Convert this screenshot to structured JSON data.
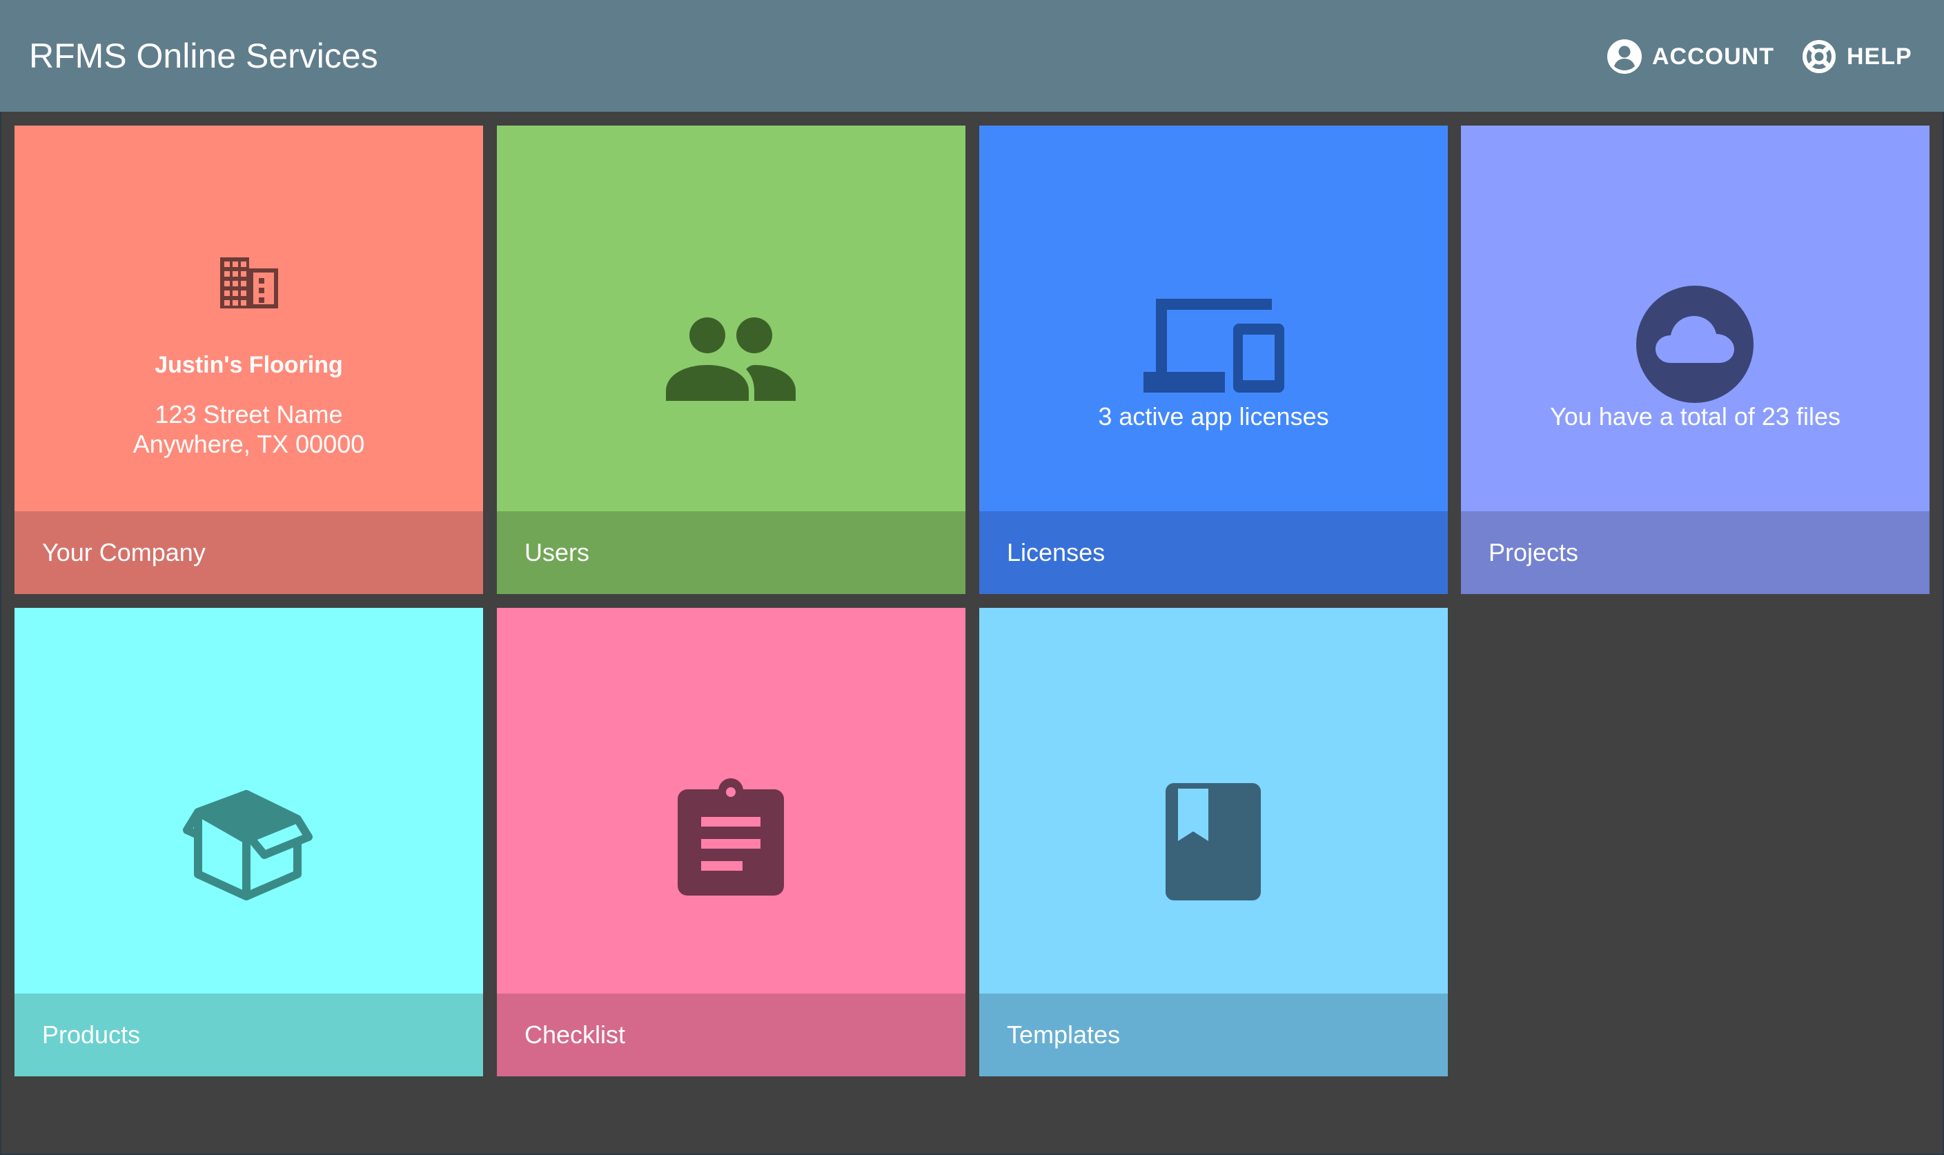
{
  "header": {
    "title": "RFMS Online Services",
    "account_label": "ACCOUNT",
    "help_label": "HELP",
    "account_icon": "account-circle-icon",
    "help_icon": "lifebuoy-icon"
  },
  "tiles": [
    {
      "id": "company",
      "label": "Your Company",
      "icon": "building-icon",
      "company_name": "Justin's Flooring",
      "address_line1": "123 Street Name",
      "address_line2": "Anywhere, TX 00000",
      "color": "#ff8a7a",
      "footer_color": "#d4726a"
    },
    {
      "id": "users",
      "label": "Users",
      "icon": "people-icon",
      "color": "#8bcb6c",
      "footer_color": "#71a657"
    },
    {
      "id": "licenses",
      "label": "Licenses",
      "icon": "devices-icon",
      "summary": "3 active app licenses",
      "color": "#4288fd",
      "footer_color": "#3770d7"
    },
    {
      "id": "projects",
      "label": "Projects",
      "icon": "cloud-icon",
      "summary": "You have a total of 23 files",
      "color": "#8b9eff",
      "footer_color": "#7482d0"
    },
    {
      "id": "products",
      "label": "Products",
      "icon": "box-icon",
      "color": "#84ffff",
      "footer_color": "#6ad1cf"
    },
    {
      "id": "checklist",
      "label": "Checklist",
      "icon": "clipboard-icon",
      "color": "#ff80a9",
      "footer_color": "#d4698c"
    },
    {
      "id": "templates",
      "label": "Templates",
      "icon": "book-icon",
      "color": "#80d7ff",
      "footer_color": "#67afd2"
    }
  ],
  "colors": {
    "background": "#414141",
    "header": "#607d8b"
  }
}
